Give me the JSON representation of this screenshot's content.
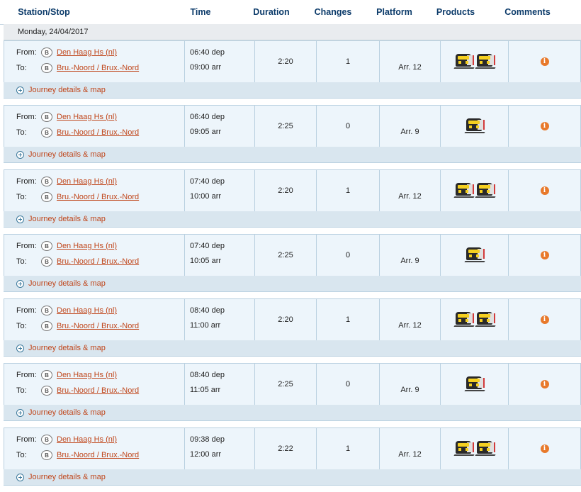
{
  "headers": {
    "station": "Station/Stop",
    "time": "Time",
    "duration": "Duration",
    "changes": "Changes",
    "platform": "Platform",
    "products": "Products",
    "comments": "Comments"
  },
  "date": "Monday, 24/04/2017",
  "labels": {
    "from": "From:",
    "to": "To:",
    "details": "Journey details & map",
    "station_badge": "B",
    "info_glyph": "i"
  },
  "journeys": [
    {
      "from": "Den Haag Hs (nl)",
      "to": "Bru.-Noord / Brux.-Nord",
      "dep": "06:40 dep",
      "arr": "09:00 arr",
      "duration": "2:20",
      "changes": "1",
      "platform": "Arr. 12",
      "trains": 2
    },
    {
      "from": "Den Haag Hs (nl)",
      "to": "Bru.-Noord / Brux.-Nord",
      "dep": "06:40 dep",
      "arr": "09:05 arr",
      "duration": "2:25",
      "changes": "0",
      "platform": "Arr. 9",
      "trains": 1
    },
    {
      "from": "Den Haag Hs (nl)",
      "to": "Bru.-Noord / Brux.-Nord",
      "dep": "07:40 dep",
      "arr": "10:00 arr",
      "duration": "2:20",
      "changes": "1",
      "platform": "Arr. 12",
      "trains": 2
    },
    {
      "from": "Den Haag Hs (nl)",
      "to": "Bru.-Noord / Brux.-Nord",
      "dep": "07:40 dep",
      "arr": "10:05 arr",
      "duration": "2:25",
      "changes": "0",
      "platform": "Arr. 9",
      "trains": 1
    },
    {
      "from": "Den Haag Hs (nl)",
      "to": "Bru.-Noord / Brux.-Nord",
      "dep": "08:40 dep",
      "arr": "11:00 arr",
      "duration": "2:20",
      "changes": "1",
      "platform": "Arr. 12",
      "trains": 2
    },
    {
      "from": "Den Haag Hs (nl)",
      "to": "Bru.-Noord / Brux.-Nord",
      "dep": "08:40 dep",
      "arr": "11:05 arr",
      "duration": "2:25",
      "changes": "0",
      "platform": "Arr. 9",
      "trains": 1
    },
    {
      "from": "Den Haag Hs (nl)",
      "to": "Bru.-Noord / Brux.-Nord",
      "dep": "09:38 dep",
      "arr": "12:00 arr",
      "duration": "2:22",
      "changes": "1",
      "platform": "Arr. 12",
      "trains": 2
    }
  ],
  "icons": {
    "station": "sncb-logo-icon",
    "train": "train-icon",
    "info": "info-icon",
    "expand": "plus-circle-icon"
  },
  "colors": {
    "header_text": "#0c3b6a",
    "link": "#c0461b",
    "row_bg": "#edf5fb",
    "details_bg": "#d9e6ef",
    "info": "#e8792b"
  }
}
